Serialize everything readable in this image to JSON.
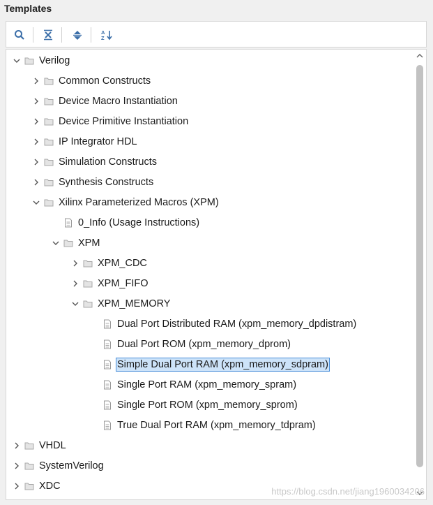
{
  "panel": {
    "title": "Templates"
  },
  "toolbar": {
    "search_icon": "search-icon",
    "collapse_all_icon": "collapse-all-icon",
    "expand_all_icon": "expand-all-icon",
    "sort_icon": "sort-az-icon"
  },
  "tree": {
    "verilog": "Verilog",
    "common_constructs": "Common Constructs",
    "device_macro": "Device Macro Instantiation",
    "device_primitive": "Device Primitive Instantiation",
    "ip_integrator": "IP Integrator HDL",
    "simulation": "Simulation Constructs",
    "synthesis": "Synthesis Constructs",
    "xpm_macros": "Xilinx Parameterized Macros (XPM)",
    "info": "0_Info (Usage Instructions)",
    "xpm": "XPM",
    "xpm_cdc": "XPM_CDC",
    "xpm_fifo": "XPM_FIFO",
    "xpm_memory": "XPM_MEMORY",
    "dpdistram": "Dual Port Distributed RAM (xpm_memory_dpdistram)",
    "dprom": "Dual Port ROM (xpm_memory_dprom)",
    "sdpram": "Simple Dual Port RAM (xpm_memory_sdpram)",
    "spram": "Single Port RAM (xpm_memory_spram)",
    "sprom": "Single Port ROM (xpm_memory_sprom)",
    "tdpram": "True Dual Port RAM (xpm_memory_tdpram)",
    "vhdl": "VHDL",
    "systemverilog": "SystemVerilog",
    "xdc": "XDC"
  },
  "watermark": "https://blog.csdn.net/jiang1960034206",
  "colors": {
    "selection_bg": "#cde3f9",
    "selection_border": "#4a8fd9",
    "folder": "#b9b9b9"
  }
}
